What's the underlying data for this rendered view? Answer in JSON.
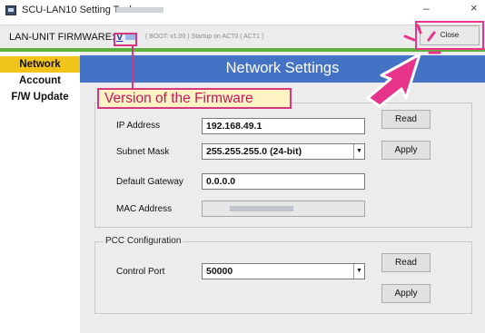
{
  "window": {
    "title": "SCU-LAN10 Setting Tool -",
    "minimize_glyph": "–",
    "close_glyph": "×"
  },
  "firmware_bar": {
    "label": "LAN-UNIT FIRMWARE:",
    "version_prefix": "V",
    "status": "( BOOT: v1.00 ) Startup on ACT0 ( ACT1 )",
    "close_label": "Close"
  },
  "sidebar": {
    "items": [
      {
        "label": "Network",
        "active": true
      },
      {
        "label": "Account",
        "active": false
      },
      {
        "label": "F/W Update",
        "active": false
      }
    ]
  },
  "main": {
    "title": "Network Settings",
    "network_group": {
      "ip_label": "IP Address",
      "ip_value": "192.168.49.1",
      "subnet_label": "Subnet Mask",
      "subnet_value": "255.255.255.0 (24-bit)",
      "gateway_label": "Default Gateway",
      "gateway_value": "0.0.0.0",
      "mac_label": "MAC Address",
      "read_label": "Read",
      "apply_label": "Apply"
    },
    "pcc_group": {
      "legend": "PCC Configuration",
      "port_label": "Control Port",
      "port_value": "50000",
      "read_label": "Read",
      "apply_label": "Apply"
    }
  },
  "annotation": {
    "callout_text": "Version of the Firmware",
    "color": "#d6377f"
  },
  "colors": {
    "header_blue": "#4472c4",
    "active_nav": "#f0c419",
    "accent_green": "#5fb13d"
  }
}
